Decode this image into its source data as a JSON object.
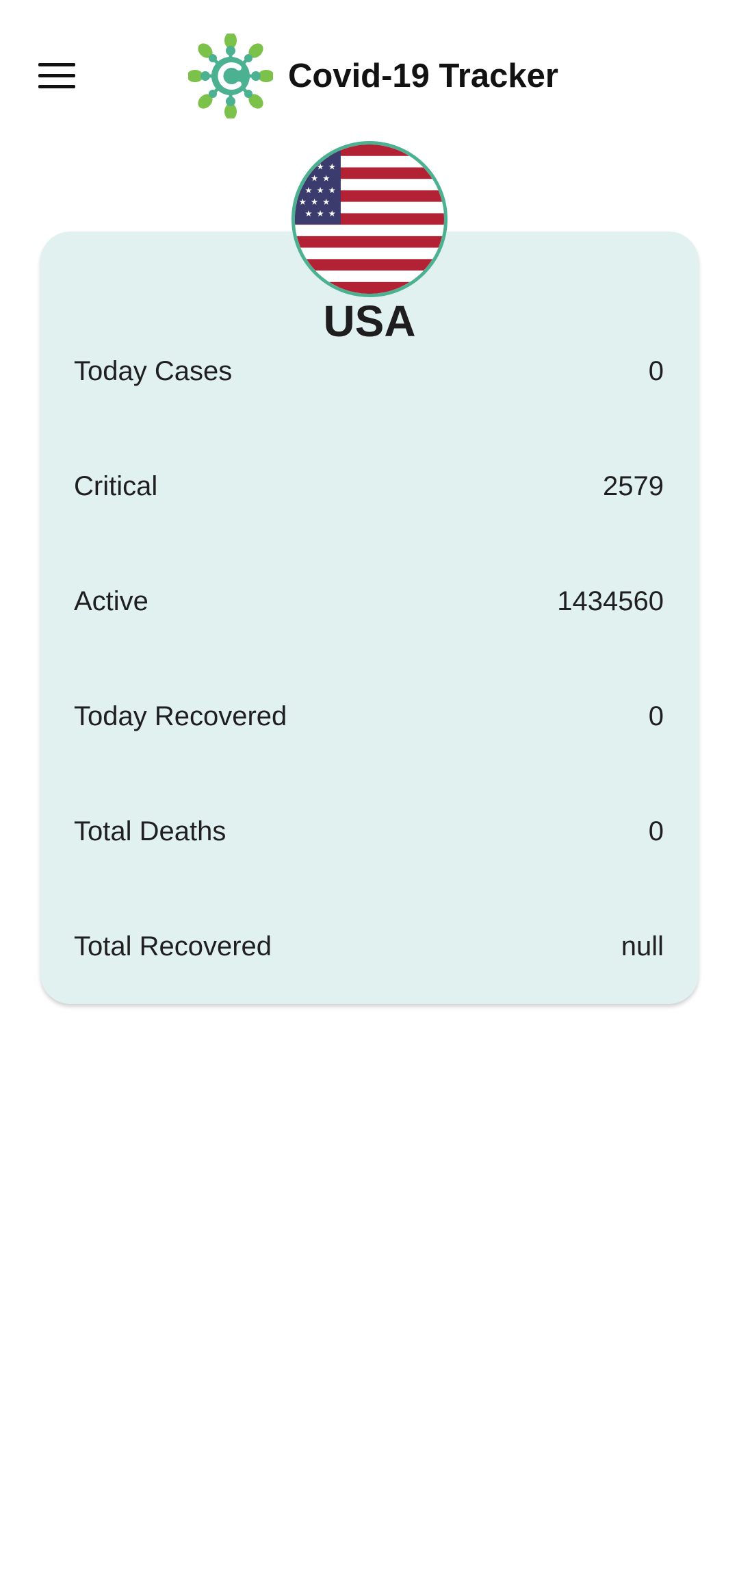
{
  "header": {
    "app_title": "Covid-19 Tracker",
    "menu_icon": "hamburger-menu-icon",
    "logo_icon": "virus-logo-icon"
  },
  "country": {
    "name": "USA",
    "flag_icon": "usa-flag-icon"
  },
  "stats": [
    {
      "label": "Today Cases",
      "value": "0"
    },
    {
      "label": "Critical",
      "value": "2579"
    },
    {
      "label": "Active",
      "value": "1434560"
    },
    {
      "label": "Today Recovered",
      "value": "0"
    },
    {
      "label": "Total Deaths",
      "value": "0"
    },
    {
      "label": "Total Recovered",
      "value": "null"
    }
  ],
  "colors": {
    "card_background": "#e0f1f0",
    "accent_teal": "#4bb191",
    "logo_green": "#7cc24a"
  }
}
